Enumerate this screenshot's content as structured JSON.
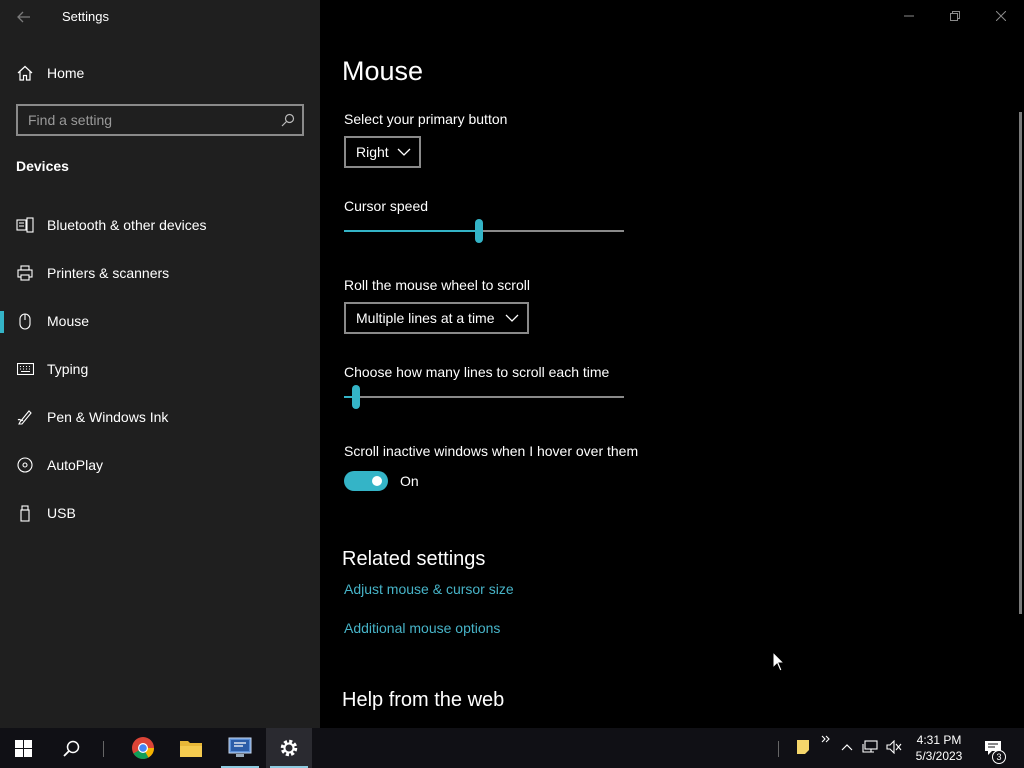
{
  "window": {
    "title": "Settings"
  },
  "sidebar": {
    "home_label": "Home",
    "search": {
      "placeholder": "Find a setting",
      "value": ""
    },
    "section": "Devices",
    "items": [
      {
        "label": "Bluetooth & other devices",
        "icon": "bluetooth-devices-icon",
        "selected": false
      },
      {
        "label": "Printers & scanners",
        "icon": "printer-icon",
        "selected": false
      },
      {
        "label": "Mouse",
        "icon": "mouse-icon",
        "selected": true
      },
      {
        "label": "Typing",
        "icon": "keyboard-icon",
        "selected": false
      },
      {
        "label": "Pen & Windows Ink",
        "icon": "pen-icon",
        "selected": false
      },
      {
        "label": "AutoPlay",
        "icon": "autoplay-icon",
        "selected": false
      },
      {
        "label": "USB",
        "icon": "usb-icon",
        "selected": false
      }
    ]
  },
  "main": {
    "title": "Mouse",
    "primary_button": {
      "label": "Select your primary button",
      "value": "Right"
    },
    "cursor_speed": {
      "label": "Cursor speed",
      "level": 0.48
    },
    "scroll_mode": {
      "label": "Roll the mouse wheel to scroll",
      "value": "Multiple lines at a time"
    },
    "scroll_lines": {
      "label": "Choose how many lines to scroll each time",
      "level": 0.03
    },
    "inactive_scroll": {
      "label": "Scroll inactive windows when I hover over them",
      "state": "On"
    },
    "related": {
      "title": "Related settings",
      "links": [
        "Adjust mouse & cursor size",
        "Additional mouse options"
      ]
    },
    "help_title": "Help from the web"
  },
  "taskbar": {
    "time": "4:31 PM",
    "date": "5/3/2023",
    "notification_count": "3"
  },
  "colors": {
    "accent": "#34b4c7",
    "link": "#47b4c8",
    "sidebar_bg": "#1f1f1f",
    "main_bg": "#000000"
  }
}
